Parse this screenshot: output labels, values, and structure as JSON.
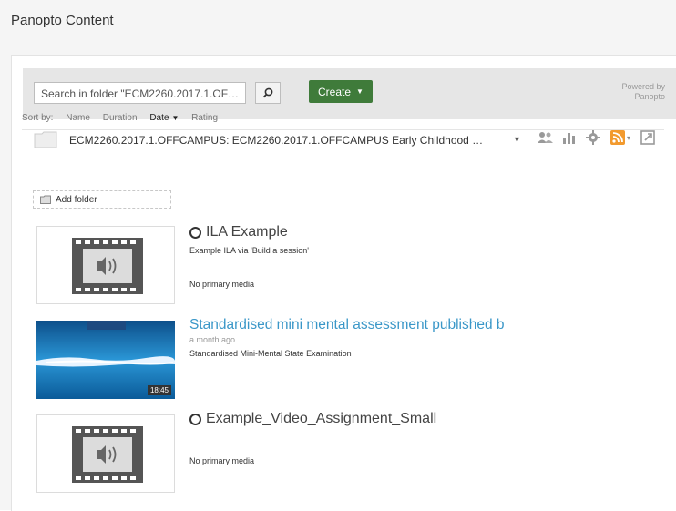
{
  "panel": {
    "title": "Panopto Content"
  },
  "toolbar": {
    "search_placeholder": "Search in folder \"ECM2260.2017.1.OF…",
    "search_icon": "search-icon",
    "create_label": "Create",
    "powered_line1": "Powered by",
    "powered_line2": "Panopto",
    "create_color": "#3f7b3a"
  },
  "folder": {
    "name": "ECM2260.2017.1.OFFCAMPUS: ECM2260.2017.1.OFFCAMPUS Early Childhood …",
    "tools": [
      "users-icon",
      "stats-icon",
      "gear-icon",
      "rss-icon",
      "external-link-icon"
    ]
  },
  "sort": {
    "label": "Sort by:",
    "options": [
      "Name",
      "Duration",
      "Date",
      "Rating"
    ],
    "active": "Date"
  },
  "add_folder_label": "Add folder",
  "sessions": [
    {
      "title": "ILA Example",
      "description": "Example ILA via 'Build a session'",
      "status": "No primary media",
      "thumbnail": "audio-placeholder"
    },
    {
      "title": "Standardised mini mental assessment published b",
      "meta": "a month ago",
      "description": "Standardised Mini-Mental State Examination",
      "duration": "18:45",
      "thumbnail": "video-thumbnail"
    },
    {
      "title": "Example_Video_Assignment_Small",
      "status": "No primary media",
      "thumbnail": "audio-placeholder"
    }
  ],
  "colors": {
    "link": "#3a97c8",
    "toolbar_bg": "#e6e6e6"
  }
}
